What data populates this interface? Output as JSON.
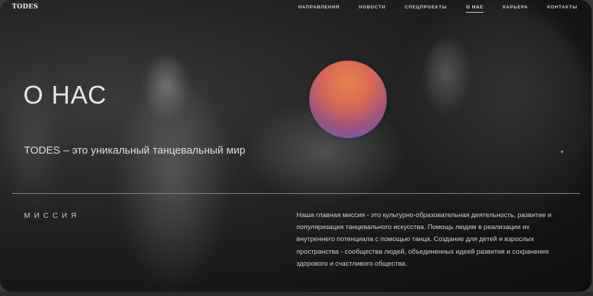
{
  "header": {
    "logo": "TODES",
    "nav": [
      {
        "label": "НАПРАВЛЕНИЯ",
        "active": false
      },
      {
        "label": "НОВОСТИ",
        "active": false
      },
      {
        "label": "СПЕЦПРОЕКТЫ",
        "active": false
      },
      {
        "label": "О НАС",
        "active": true
      },
      {
        "label": "КАРЬЕРА",
        "active": false
      },
      {
        "label": "КОНТАКТЫ",
        "active": false
      }
    ]
  },
  "hero": {
    "title": "О НАС",
    "subtitle": "TODES – это уникальный танцевальный мир"
  },
  "mission": {
    "label": "МИССИЯ",
    "text": "Наша главная миссия - это культурно-образовательная деятельность, развитие и популяризация танцевального искусства. Помощь людям в реализации их внутреннего потенциала с помощью танца. Создание для детей и взрослых пространства - сообщества людей, объединенных идеей развития и сохранения здорового и счастливого общества."
  },
  "colors": {
    "sphere_top": "#e8804a",
    "sphere_bottom": "#5a5cc0",
    "background": "#151515"
  }
}
